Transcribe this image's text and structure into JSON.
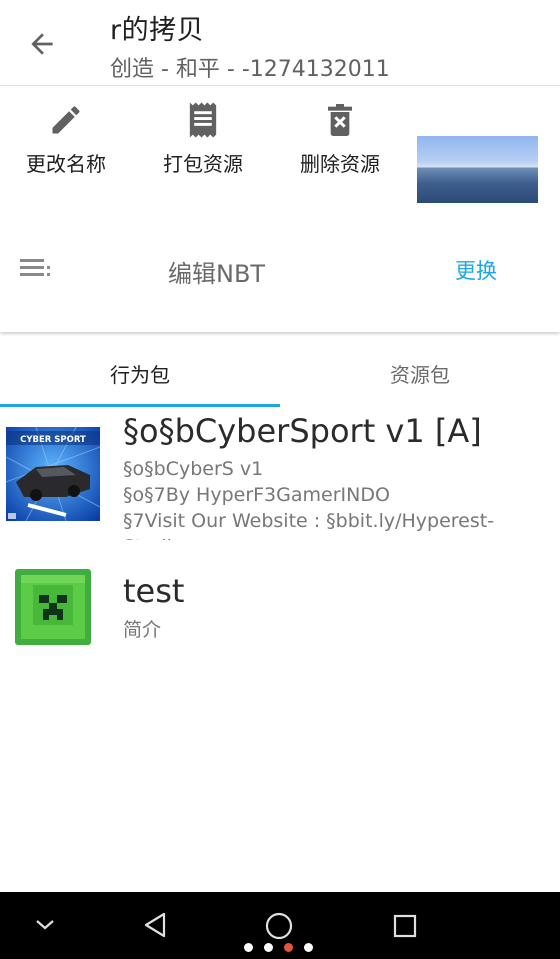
{
  "header": {
    "title": "r的拷贝",
    "subtitle": "创造 - 和平 - -1274132011"
  },
  "actions": {
    "rename_label": "更改名称",
    "pack_label": "打包资源",
    "delete_label": "删除资源"
  },
  "nbt": {
    "label": "编辑NBT",
    "swap_label": "更换"
  },
  "tabs": [
    {
      "label": "行为包",
      "active": true
    },
    {
      "label": "资源包",
      "active": false
    }
  ],
  "packs": [
    {
      "name": "§o§bCyberSport v1 [A]",
      "description": "§o§bCyberS v1\n§o§7By HyperF3GamerINDO\n§7Visit Our Website : §bbit.ly/Hyperest-\nStudio",
      "thumbnail_text": "CYBER SPORT"
    },
    {
      "name": "test",
      "description": "简介"
    }
  ],
  "colors": {
    "accent": "#1ea7e6",
    "navbar": "#000000",
    "active_dot": "#e7533f"
  },
  "navbar": {
    "page_dots_count": 4,
    "active_dot_index": 2
  }
}
